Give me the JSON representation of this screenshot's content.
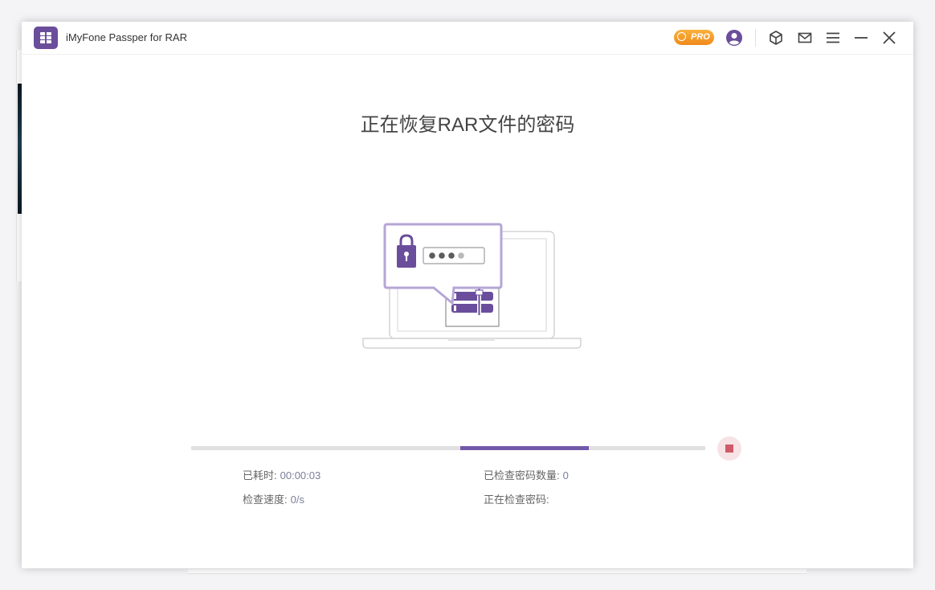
{
  "window": {
    "title": "iMyFone Passper for RAR"
  },
  "header": {
    "pro_badge": "PRO"
  },
  "main": {
    "title": "正在恢复RAR文件的密码",
    "progress": {
      "segment_start_fraction": 0.523,
      "segment_end_fraction": 0.773
    },
    "stats": {
      "elapsed_label": "已耗时:",
      "elapsed_value": "00:00:03",
      "checked_label": "已检查密码数量:",
      "checked_value": "0",
      "speed_label": "检查速度:",
      "speed_value": "0/s",
      "current_label": "正在检查密码:",
      "current_value": ""
    }
  },
  "colors": {
    "accent": "#7158a8",
    "stop": "#d05a68",
    "pro": "#f39a2b"
  },
  "icons": [
    "app-logo-icon",
    "pro-icon",
    "account-icon",
    "cube-icon",
    "mail-icon",
    "menu-icon",
    "minimize-icon",
    "close-icon",
    "lock-icon",
    "stop-icon"
  ]
}
